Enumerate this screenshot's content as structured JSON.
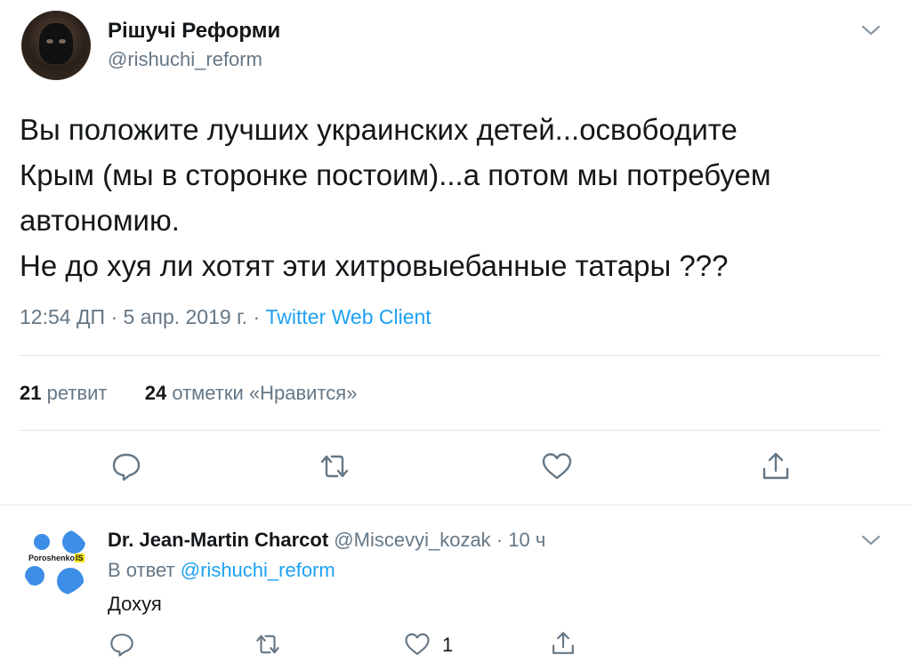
{
  "tweet": {
    "author_name": "Рішучі Реформи",
    "author_handle": "@rishuchi_reform",
    "text_lines": [
      "Вы положите лучших украинских детей...освободите",
      "Крым (мы в сторонке постоим)...а потом мы потребуем",
      "автономию.",
      "Не до хуя ли хотят эти хитровыебанные татары ???"
    ],
    "time": "12:54 ДП",
    "date": "5 апр. 2019 г.",
    "separator": "·",
    "client": "Twitter Web Client",
    "retweets_count": "21",
    "retweets_label": "ретвит",
    "likes_count": "24",
    "likes_label": "отметки «Нравится»"
  },
  "reply": {
    "author_name": "Dr. Jean-Martin Charcot",
    "author_handle": "@Miscevyi_kozak",
    "time_ago": "10 ч",
    "separator": "·",
    "in_reply_prefix": "В ответ",
    "in_reply_mention": "@rishuchi_reform",
    "text": "Дохуя",
    "likes_count": "1",
    "avatar_logo_text": "Poroshenko",
    "avatar_logo_badge": "IS"
  },
  "colors": {
    "text": "#14171a",
    "secondary": "#657786",
    "link": "#1da1f2",
    "icon": "#657786",
    "divider": "#e1e8ed"
  },
  "icons": [
    "chevron-down-icon",
    "reply-icon",
    "retweet-icon",
    "like-icon",
    "share-icon"
  ]
}
